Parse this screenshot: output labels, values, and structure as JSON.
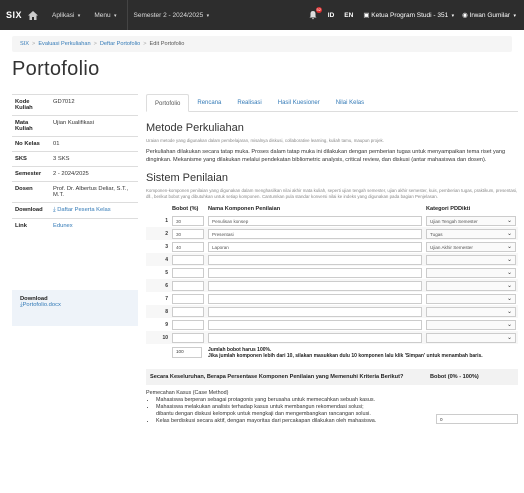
{
  "nav": {
    "brand": "SIX",
    "items": [
      "Aplikasi",
      "Menu",
      "Semester 2 - 2024/2025"
    ],
    "notif_count": "52",
    "id_label": "ID",
    "en_label": "EN",
    "role": "Ketua Program Studi - 351",
    "user": "Irwan Gumilar"
  },
  "breadcrumb": [
    "SIX",
    "Evaluasi Perkuliahan",
    "Deftar Portofolio",
    "Edit Portofolio"
  ],
  "title": "Portofolio",
  "info": [
    {
      "k": "Kode Kuliah",
      "v": "GD7012"
    },
    {
      "k": "Mata Kuliah",
      "v": "Ujian Kualifikasi"
    },
    {
      "k": "No Kelas",
      "v": "01"
    },
    {
      "k": "SKS",
      "v": "3 SKS"
    },
    {
      "k": "Semester",
      "v": "2 - 2024/2025"
    },
    {
      "k": "Dosen",
      "v": "Prof. Dr. Albertus Deliar, S.T., M.T."
    },
    {
      "k": "Download",
      "v": "Daftar Peserta Kelas"
    },
    {
      "k": "Link",
      "v": "Edunex"
    }
  ],
  "download": {
    "title": "Download",
    "file": "Portofolio.docx"
  },
  "tabs": [
    "Portofolio",
    "Rencana",
    "Realisasi",
    "Hasil Kuesioner",
    "Nilai Kelas"
  ],
  "metode": {
    "heading": "Metode Perkuliahan",
    "sub": "Uraian metode yang digunakan dalam pembelajaran, misalnya diskusi, collaborative learning, kuliah tamu, maupun projek.",
    "text": "Perkuliahan dilakukan secara tatap muka. Proses dalam tatap muka ini dilakukan dengan pemberian tugas untuk menyampaikan tema riset yang dinginkan. Mekanisme yang dilakukan melalui pendekatan bibliometric analysis, critical review, dan diskusi (antar mahasiswa dan dosen)."
  },
  "sistem": {
    "heading": "Sistem Penilaian",
    "sub": "Komponen-komponen penilaian yang digunakan dalam menghasilkan nilai akhir mata kuliah, seperti ujian tengah semester, ujian akhir semester, kuis, pemberian tugas, praktikum, presentasi, dll., berikut bobot yang dibutuhkan untuk setiap komponen. Cantumkan pula standar konversi nilai ke indeks yang digunakan pada bagian Penjelasan.",
    "headers": [
      "Bobot (%)",
      "Nama Komponen Penilaian",
      "Kategori PDDikti"
    ],
    "rows": [
      {
        "n": "1",
        "bobot": "30",
        "nama": "Penulisan konsep",
        "kat": "Ujian Tengah Semester"
      },
      {
        "n": "2",
        "bobot": "30",
        "nama": "Presentasi",
        "kat": "Tugas"
      },
      {
        "n": "3",
        "bobot": "40",
        "nama": "Laporan",
        "kat": "Ujian Akhir Semester"
      },
      {
        "n": "4",
        "bobot": "",
        "nama": "",
        "kat": ""
      },
      {
        "n": "5",
        "bobot": "",
        "nama": "",
        "kat": ""
      },
      {
        "n": "6",
        "bobot": "",
        "nama": "",
        "kat": ""
      },
      {
        "n": "7",
        "bobot": "",
        "nama": "",
        "kat": ""
      },
      {
        "n": "8",
        "bobot": "",
        "nama": "",
        "kat": ""
      },
      {
        "n": "9",
        "bobot": "",
        "nama": "",
        "kat": ""
      },
      {
        "n": "10",
        "bobot": "",
        "nama": "",
        "kat": ""
      }
    ],
    "total": "100",
    "note1": "Jumlah bobot harus 100%.",
    "note2": "Jika jumlah komponen lebih dari 10, silakan masukkan dulu 10 komponen lalu klik 'Simpan' untuk menambah baris."
  },
  "question": {
    "text": "Secara Keseluruhan, Berapa Persentase Komponen Penilaian yang Memenuhi Kriteria Berikut?",
    "bobot": "Bobot (0% - 100%)",
    "case_title": "Pemecahan Kasus (Case Method)",
    "bullets": [
      "Mahasiswa berperan sebagai protagonis yang berusaha untuk memecahkan sebuah kasus.",
      "Mahasiswa melakukan analisis terhadap kasus untuk membangun rekomendasi solusi;",
      "dibantu dengan diskusi kelompok untuk mengkaji dan mengembangkan rancangan solusi.",
      "Kelas berdiskusi secara aktif, dengan mayoritas dari percakapan dilakukan oleh mahasiswa."
    ],
    "answer": "0"
  }
}
